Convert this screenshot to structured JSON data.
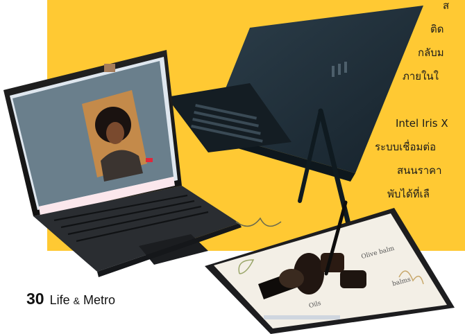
{
  "article": {
    "text_lines": [
      "ส",
      "ติด",
      "กลับม",
      "ภายในใ",
      "Intel Iris X",
      "ระบบเชื่อมต่อ",
      "สนนราคา",
      "พับได้ที่เลื"
    ]
  },
  "footer": {
    "page_number": "30",
    "section_name": "Life",
    "section_amp": "&",
    "section_name_2": "Metro"
  },
  "screen_labels": {
    "label_1": "Olive balm",
    "label_2": "balms",
    "label_3": "Oils"
  },
  "colors": {
    "accent_yellow": "#FFC933",
    "device_dark": "#1c2a33"
  }
}
